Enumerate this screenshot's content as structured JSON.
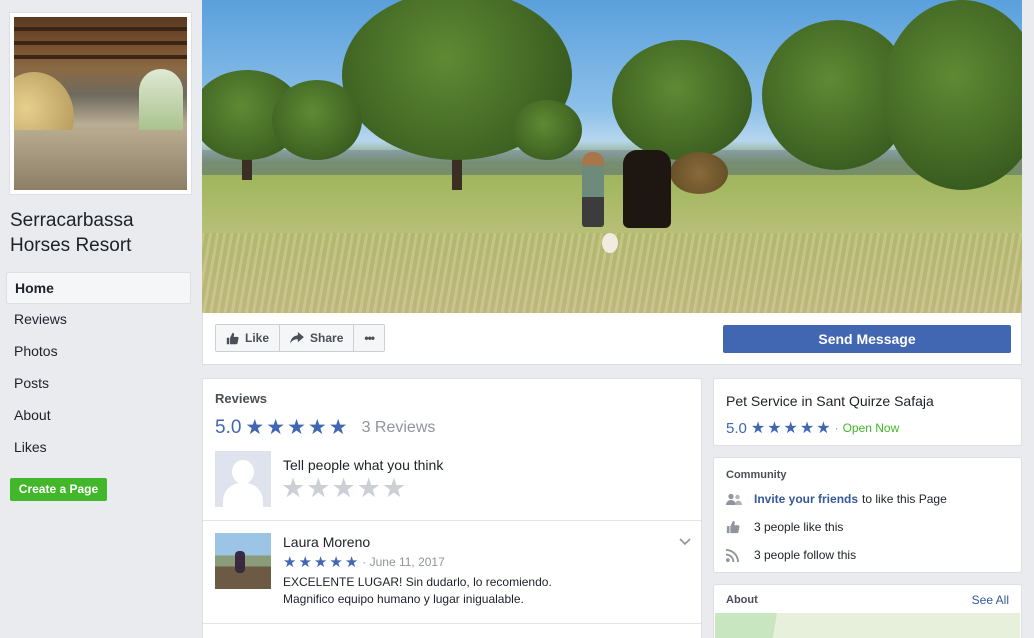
{
  "sidebar": {
    "page_name": "Serracarbassa Horses Resort",
    "nav_items": [
      {
        "label": "Home",
        "active": true
      },
      {
        "label": "Reviews"
      },
      {
        "label": "Photos"
      },
      {
        "label": "Posts"
      },
      {
        "label": "About"
      },
      {
        "label": "Likes"
      }
    ],
    "create_page_label": "Create a Page"
  },
  "actions": {
    "like_label": "Like",
    "share_label": "Share",
    "more_label": "•••",
    "send_message_label": "Send Message"
  },
  "reviews": {
    "title": "Reviews",
    "rating": "5.0",
    "stars": 5,
    "count_label": "3 Reviews",
    "prompt": "Tell people what you think",
    "items": [
      {
        "author": "Laura Moreno",
        "stars": 5,
        "date": "· June 11, 2017",
        "text_line1": "EXCELENTE LUGAR! Sin dudarlo, lo recomiendo.",
        "text_line2": "Magnifico equipo humano y lugar inigualable."
      }
    ]
  },
  "info": {
    "category": "Pet Service in Sant Quirze Safaja",
    "rating": "5.0",
    "stars": 5,
    "separator": "·",
    "status": "Open Now"
  },
  "community": {
    "heading": "Community",
    "invite_link": "Invite your friends",
    "invite_rest": "to like this Page",
    "likes": "3 people like this",
    "follows": "3 people follow this"
  },
  "about": {
    "heading": "About",
    "see_all": "See All"
  },
  "colors": {
    "brand_blue": "#4267b2",
    "link_blue": "#365899",
    "green": "#42b72a",
    "background": "#e9ebee"
  },
  "icons": [
    "thumbs-up-icon",
    "share-arrow-icon",
    "more-dots-icon",
    "star-icon",
    "invite-friends-icon",
    "like-icon",
    "follow-rss-icon",
    "chevron-down-icon"
  ]
}
